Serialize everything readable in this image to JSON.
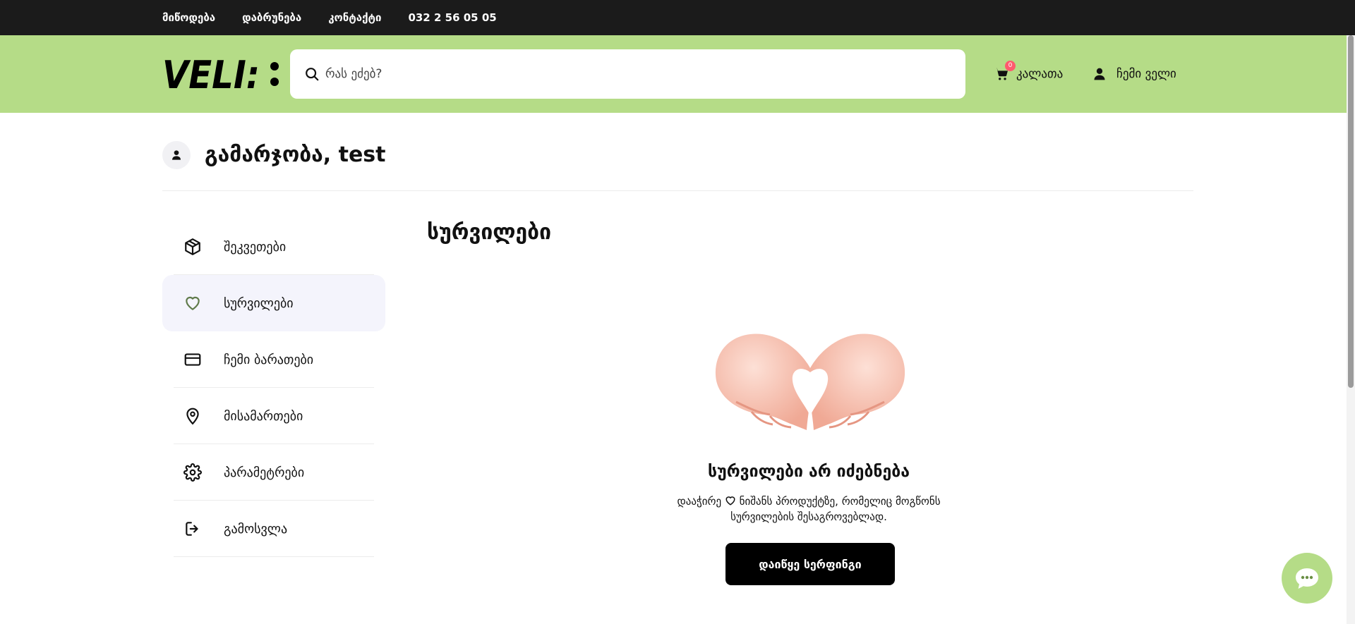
{
  "topbar": {
    "links": [
      "მიწოდება",
      "დაბრუნება",
      "კონტაქტი",
      "032 2 56 05 05"
    ]
  },
  "header": {
    "logo_text": "VELI:",
    "search_placeholder": "რას ეძებ?",
    "cart_label": "კალათა",
    "cart_count": "0",
    "account_label": "ჩემი ველი"
  },
  "greeting": "გამარჯობა, test",
  "sidebar": {
    "items": [
      {
        "label": "შეკვეთები",
        "icon": "package-icon"
      },
      {
        "label": "სურვილები",
        "icon": "heart-icon",
        "active": true
      },
      {
        "label": "ჩემი ბარათები",
        "icon": "credit-card-icon"
      },
      {
        "label": "მისამართები",
        "icon": "map-pin-icon"
      },
      {
        "label": "პარამეტრები",
        "icon": "gear-icon"
      },
      {
        "label": "გამოსვლა",
        "icon": "logout-icon"
      }
    ]
  },
  "main": {
    "title": "სურვილები",
    "empty_title": "სურვილები არ იძებნება",
    "empty_desc_before": "დააჭირე",
    "empty_desc_after": "ნიშანს პროდუქტზე, რომელიც მოგწონს სურვილების შესაგროვებლად.",
    "cta_label": "დაიწყე სერფინგი"
  },
  "colors": {
    "header_bg": "#b5dc87",
    "topbar_bg": "#1b1b1b",
    "badge": "#ff5a6e",
    "active_item_bg": "#f4f4fc"
  }
}
